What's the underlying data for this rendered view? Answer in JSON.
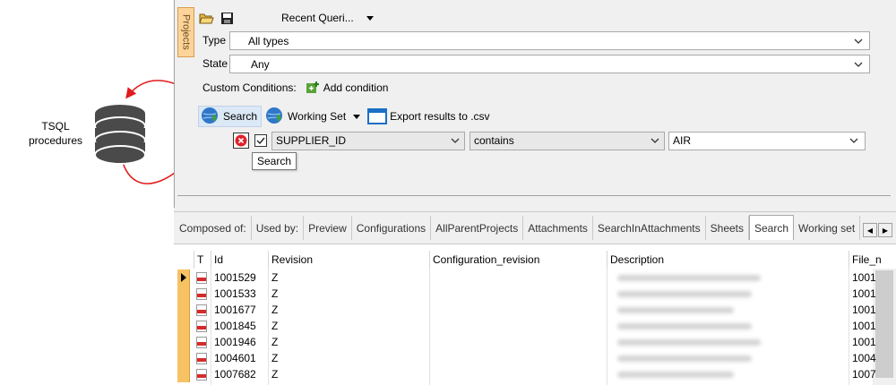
{
  "annotation": {
    "database_label_line1": "TSQL",
    "database_label_line2": "procedures"
  },
  "sidebar": {
    "projects_tab": "Projects"
  },
  "toolbar": {
    "recent_queries": "Recent Queri..."
  },
  "filters": {
    "type_label": "Type",
    "type_value": "All types",
    "state_label": "State",
    "state_value": "Any"
  },
  "custom_conditions": {
    "label": "Custom Conditions:",
    "add_label": "Add condition"
  },
  "actions": {
    "search": "Search",
    "working_set": "Working Set",
    "export": "Export results to .csv"
  },
  "condition": {
    "field": "SUPPLIER_ID",
    "operator": "contains",
    "value": "AIR",
    "checked": true
  },
  "tooltip": "Search",
  "tabs": [
    {
      "label": "Composed of:"
    },
    {
      "label": "Used by:"
    },
    {
      "label": "Preview"
    },
    {
      "label": "Configurations"
    },
    {
      "label": "AllParentProjects"
    },
    {
      "label": "Attachments"
    },
    {
      "label": "SearchInAttachments"
    },
    {
      "label": "Sheets"
    },
    {
      "label": "Search",
      "active": true
    },
    {
      "label": "Working set"
    }
  ],
  "grid": {
    "columns": [
      "T",
      "Id",
      "Revision",
      "Configuration_revision",
      "Description",
      "File_n"
    ],
    "rows": [
      {
        "id": "1001529",
        "revision": "Z",
        "file": "1001"
      },
      {
        "id": "1001533",
        "revision": "Z",
        "file": "1001"
      },
      {
        "id": "1001677",
        "revision": "Z",
        "file": "1001"
      },
      {
        "id": "1001845",
        "revision": "Z",
        "file": "1001"
      },
      {
        "id": "1001946",
        "revision": "Z",
        "file": "1001"
      },
      {
        "id": "1004601",
        "revision": "Z",
        "file": "1004"
      },
      {
        "id": "1007682",
        "revision": "Z",
        "file": "1007"
      }
    ]
  },
  "colors": {
    "annotation_arrow": "#e01b1b",
    "row_header": "#f6c264",
    "projects_tab": "#fcd49a",
    "search_highlight": "#dbe8f6"
  }
}
